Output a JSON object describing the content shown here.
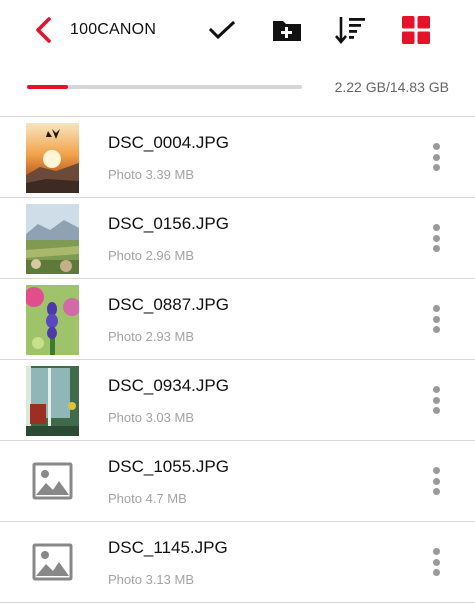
{
  "header": {
    "folder_name": "100CANON",
    "icons": [
      "back-chevron",
      "checkmark",
      "new-folder",
      "sort-descending",
      "grid-view"
    ],
    "accent_color": "#e4132b"
  },
  "storage": {
    "used_label": "2.22 GB/14.83 GB",
    "used_fraction": 0.15
  },
  "files": [
    {
      "name": "DSC_0004.JPG",
      "info": "Photo 3.39 MB",
      "thumb": "sunset"
    },
    {
      "name": "DSC_0156.JPG",
      "info": "Photo 2.96 MB",
      "thumb": "landscape"
    },
    {
      "name": "DSC_0887.JPG",
      "info": "Photo 2.93 MB",
      "thumb": "flowers"
    },
    {
      "name": "DSC_0934.JPG",
      "info": "Photo 3.03 MB",
      "thumb": "window"
    },
    {
      "name": "DSC_1055.JPG",
      "info": "Photo 4.7 MB",
      "thumb": "placeholder"
    },
    {
      "name": "DSC_1145.JPG",
      "info": "Photo 3.13 MB",
      "thumb": "placeholder"
    }
  ]
}
